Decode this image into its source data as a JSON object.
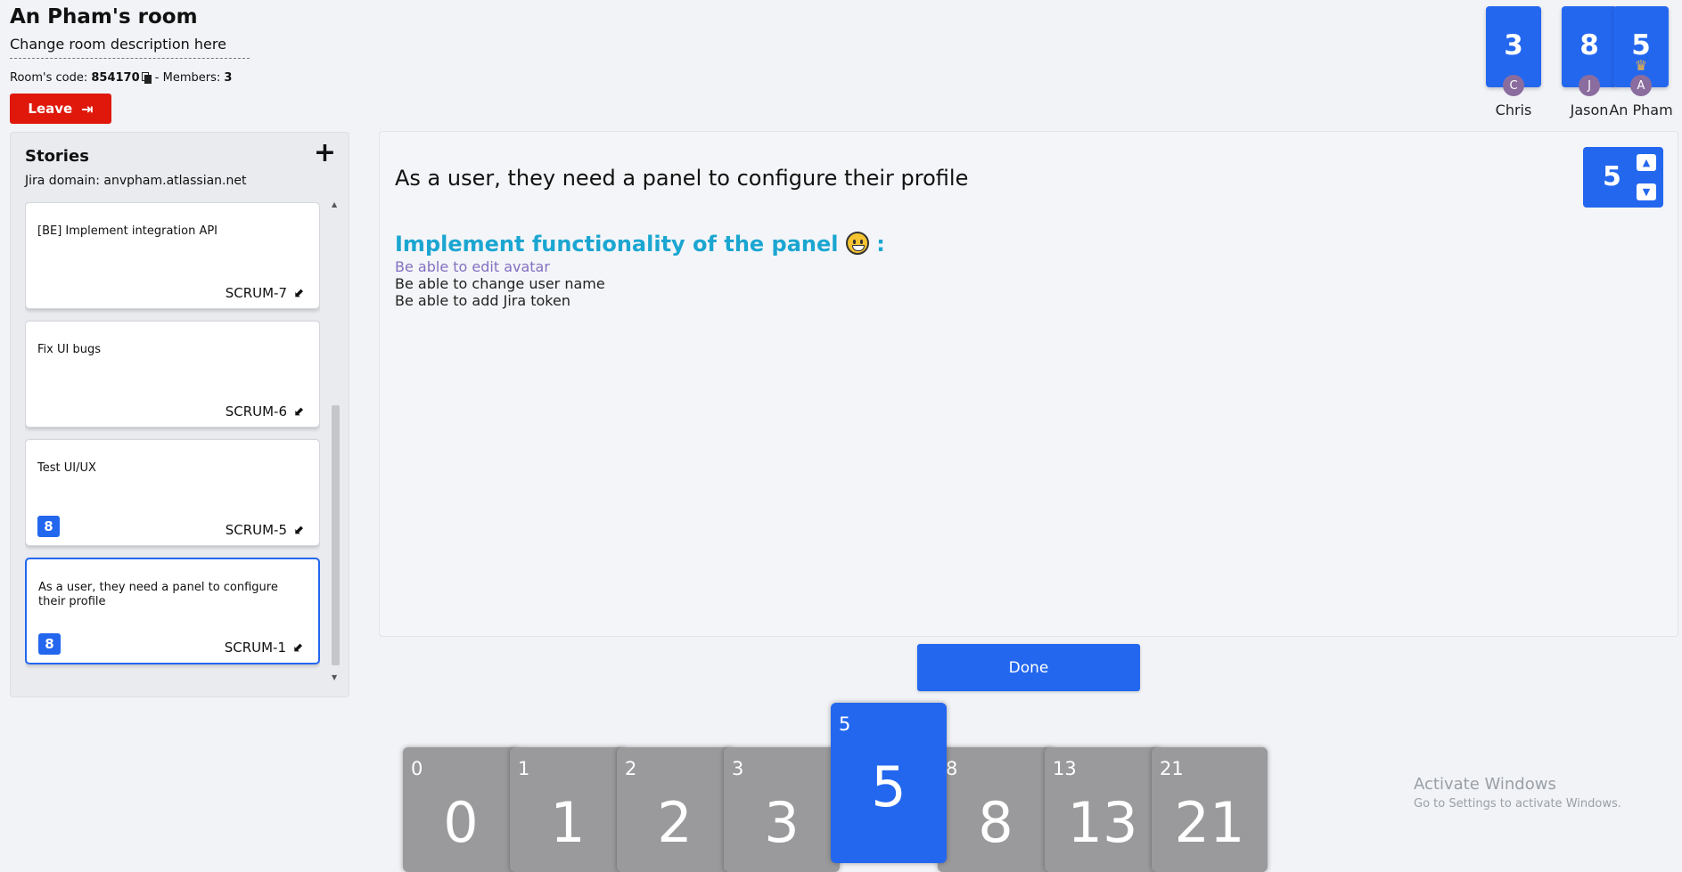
{
  "room": {
    "title": "An Pham's room",
    "description": "Change room description here",
    "code_label": "Room's code:",
    "code": "854170",
    "members_label": "- Members:",
    "members_count": "3",
    "leave_label": "Leave"
  },
  "members": [
    {
      "name": "Chris",
      "vote": "3",
      "initial": "C",
      "host": false
    },
    {
      "name": "Jason",
      "vote": "8",
      "initial": "J",
      "host": false
    },
    {
      "name": "An Pham",
      "vote": "5",
      "initial": "A",
      "host": true
    }
  ],
  "stories": {
    "title": "Stories",
    "jira_domain": "Jira domain: anvpham.atlassian.net",
    "items": [
      {
        "text": "[BE] Implement integration API",
        "key": "SCRUM-7",
        "points": ""
      },
      {
        "text": "Fix UI bugs",
        "key": "SCRUM-6",
        "points": ""
      },
      {
        "text": "Test UI/UX",
        "key": "SCRUM-5",
        "points": "8"
      },
      {
        "text": "As a user, they need a panel to configure their profile",
        "key": "SCRUM-1",
        "points": "8"
      }
    ]
  },
  "detail": {
    "title": "As a user, they need a panel to configure their profile",
    "points": "5",
    "heading": "Implement functionality of the panel",
    "heading_suffix": ":",
    "lines": [
      "Be able to edit avatar",
      "Be able to change user name",
      "Be able to add Jira token"
    ]
  },
  "done_label": "Done",
  "deck": [
    "0",
    "1",
    "2",
    "3",
    "5",
    "8",
    "13",
    "21"
  ],
  "deck_selected": "5",
  "watermark": {
    "title": "Activate Windows",
    "subtitle": "Go to Settings to activate Windows."
  },
  "colors": {
    "primary": "#2367ef",
    "danger": "#e0180c",
    "heading": "#1ba6d1",
    "card_gray": "#9a9a9c"
  }
}
